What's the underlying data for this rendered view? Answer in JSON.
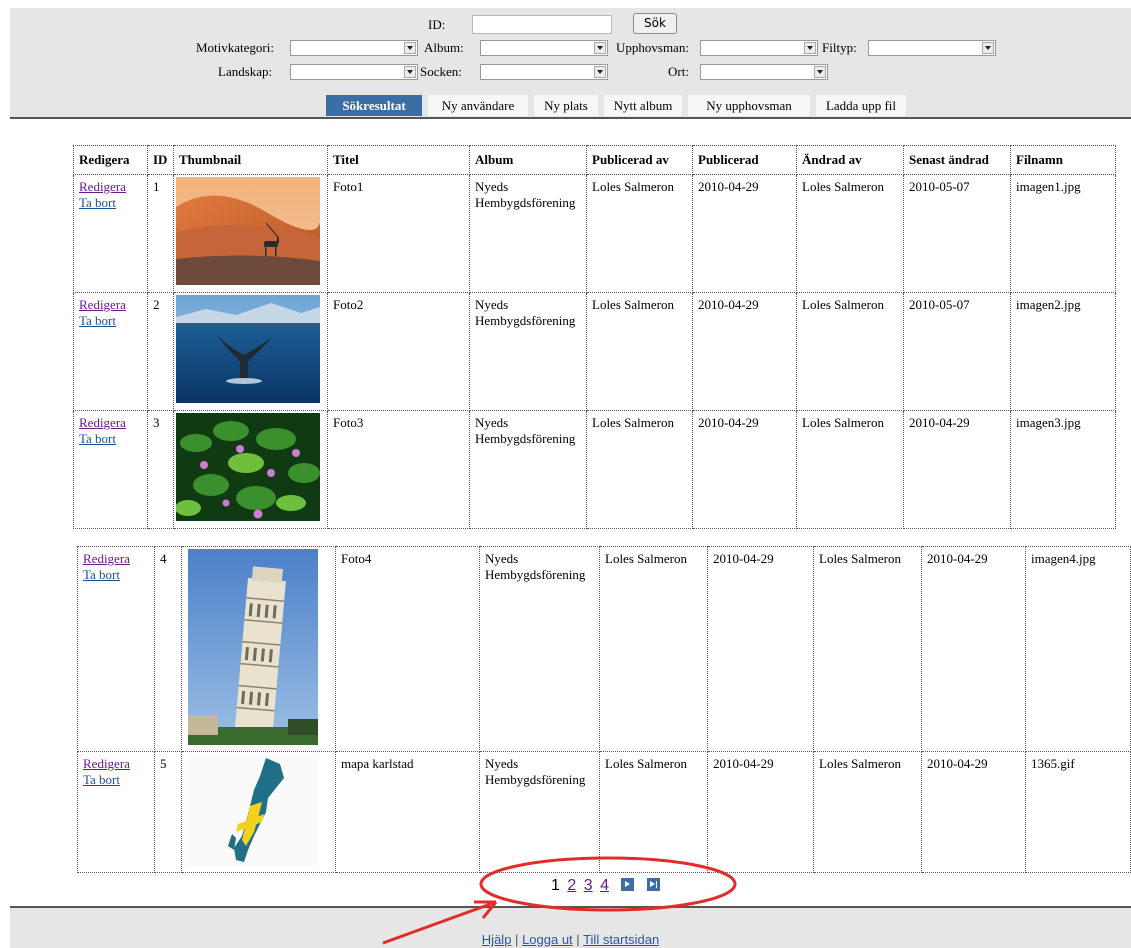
{
  "search": {
    "id_label": "ID:",
    "id_value": "",
    "search_button": "Sök",
    "motivkategori_label": "Motivkategori:",
    "album_label": "Album:",
    "upphovsman_label": "Upphovsman:",
    "filtyp_label": "Filtyp:",
    "landskap_label": "Landskap:",
    "socken_label": "Socken:",
    "ort_label": "Ort:"
  },
  "tabs": [
    {
      "label": "Sökresultat"
    },
    {
      "label": "Ny användare"
    },
    {
      "label": "Ny plats"
    },
    {
      "label": "Nytt album"
    },
    {
      "label": "Ny upphovsman"
    },
    {
      "label": "Ladda upp fil"
    }
  ],
  "table": {
    "headers": [
      "Redigera",
      "ID",
      "Thumbnail",
      "Titel",
      "Album",
      "Publicerad av",
      "Publicerad",
      "Ändrad av",
      "Senast ändrad",
      "Filnamn"
    ],
    "edit_link": "Redigera",
    "delete_link": "Ta bort",
    "rows": [
      {
        "id": "1",
        "title": "Foto1",
        "album": "Nyeds Hembygdsförening",
        "published_by": "Loles Salmeron",
        "published": "2010-04-29",
        "changed_by": "Loles Salmeron",
        "last_changed": "2010-05-07",
        "filename": "imagen1.jpg",
        "thumb": "desert-oryx"
      },
      {
        "id": "2",
        "title": "Foto2",
        "album": "Nyeds Hembygdsförening",
        "published_by": "Loles Salmeron",
        "published": "2010-04-29",
        "changed_by": "Loles Salmeron",
        "last_changed": "2010-05-07",
        "filename": "imagen2.jpg",
        "thumb": "whale-tail"
      },
      {
        "id": "3",
        "title": "Foto3",
        "album": "Nyeds Hembygdsförening",
        "published_by": "Loles Salmeron",
        "published": "2010-04-29",
        "changed_by": "Loles Salmeron",
        "last_changed": "2010-04-29",
        "filename": "imagen3.jpg",
        "thumb": "green-flowers"
      },
      {
        "id": "4",
        "title": "Foto4",
        "album": "Nyeds Hembygdsförening",
        "published_by": "Loles Salmeron",
        "published": "2010-04-29",
        "changed_by": "Loles Salmeron",
        "last_changed": "2010-04-29",
        "filename": "imagen4.jpg",
        "thumb": "leaning-tower"
      },
      {
        "id": "5",
        "title": "mapa karlstad",
        "album": "Nyeds Hembygdsförening",
        "published_by": "Loles Salmeron",
        "published": "2010-04-29",
        "changed_by": "Loles Salmeron",
        "last_changed": "2010-04-29",
        "filename": "1365.gif",
        "thumb": "sweden-map"
      }
    ]
  },
  "pager": {
    "current": "1",
    "pages": [
      "2",
      "3",
      "4"
    ],
    "next_icon": "next-page-icon",
    "last_icon": "last-page-icon"
  },
  "footer": {
    "help": "Hjälp",
    "logout": "Logga ut",
    "home": "Till startsidan",
    "separator": "|"
  },
  "annotation": {
    "color": "#e32b2b"
  }
}
